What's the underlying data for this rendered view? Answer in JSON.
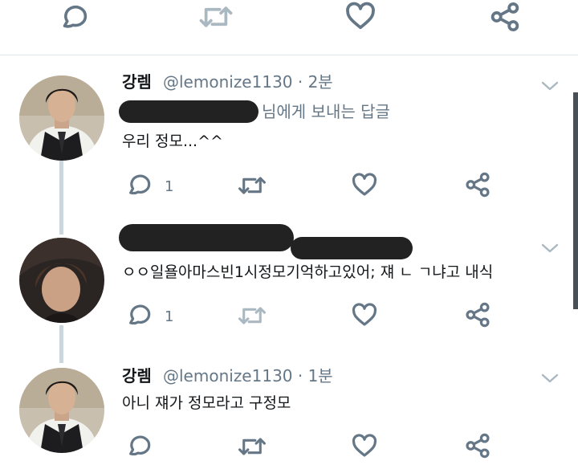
{
  "top_actions": {
    "like_count": "",
    "retweet_count": "",
    "reply_count": ""
  },
  "tweets": [
    {
      "name": "강렘",
      "handle_time": "@lemonize1130 · 2분",
      "reply_to_suffix": "님에게 보내는 답글",
      "text": "우리 정모...^^",
      "reply_count": "1"
    },
    {
      "text": "ㅇㅇ일욜아마스빈1시정모기억하고있어; 쟤 ㄴ ㄱ냐고 내식",
      "reply_count": "1"
    },
    {
      "name": "강렘",
      "handle_time": "@lemonize1130 · 1분",
      "text": "아니 쟤가 정모라고 구정모"
    }
  ],
  "colors": {
    "icon_gray": "#657786",
    "icon_light": "#aab8c2",
    "divider": "#e1e8ed",
    "thread_line": "#ccd6dd"
  },
  "icons": [
    "reply-icon",
    "retweet-icon",
    "like-icon",
    "share-icon",
    "chevron-down-icon"
  ]
}
